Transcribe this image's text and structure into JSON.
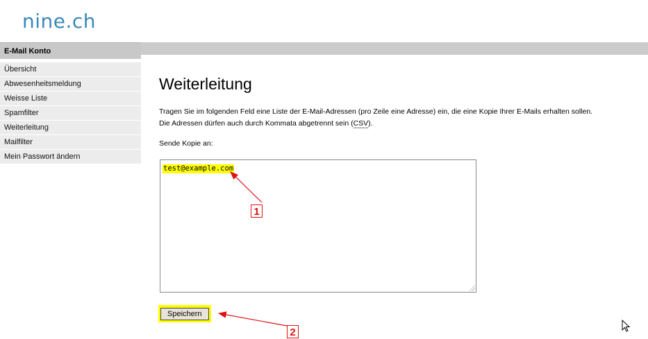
{
  "logo": "nine.ch",
  "sidebar": {
    "title": "E-Mail Konto",
    "items": [
      {
        "label": "Übersicht"
      },
      {
        "label": "Abwesenheitsmeldung"
      },
      {
        "label": "Weisse Liste"
      },
      {
        "label": "Spamfilter"
      },
      {
        "label": "Weiterleitung"
      },
      {
        "label": "Mailfilter"
      },
      {
        "label": "Mein Passwort ändern"
      }
    ]
  },
  "main": {
    "title": "Weiterleitung",
    "intro_line1": "Tragen Sie im folgenden Feld eine Liste der E-Mail-Adressen (pro Zeile eine Adresse) ein, die eine Kopie Ihrer E-Mails erhalten sollen.",
    "intro_line2_pre": "Die Adressen dürfen auch durch Kommata abgetrennt sein (",
    "intro_line2_abbr": "CSV",
    "intro_line2_post": ").",
    "field_label": "Sende Kopie an:",
    "field_value": "test@example.com",
    "save_label": "Speichern"
  },
  "annotations": {
    "callout_1": "1",
    "callout_2": "2",
    "color": "#e01010",
    "highlight_color": "#ffff00"
  }
}
